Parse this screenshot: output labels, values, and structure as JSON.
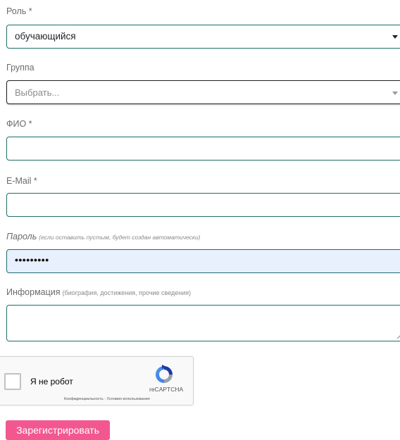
{
  "form": {
    "role": {
      "label": "Роль *",
      "value": "обучающийся"
    },
    "group": {
      "label": "Группа",
      "placeholder": "Выбрать..."
    },
    "fio": {
      "label": "ФИО *",
      "value": ""
    },
    "email": {
      "label": "E-Mail *",
      "value": ""
    },
    "password": {
      "label": "Пароль",
      "hint": "(если оставить пустым, будет создан автоматически)",
      "value": "•••••••••"
    },
    "info": {
      "label": "Информация",
      "note": "(биография, достижения, прочие сведения)",
      "value": ""
    },
    "captcha": {
      "checkbox_label": "Я не робот",
      "brand": "reCAPTCHA",
      "terms": "Конфиденциальность - Условия использования"
    },
    "submit_label": "Зарегистрировать"
  },
  "colors": {
    "input_border": "#1f6d6a",
    "autofill_bg": "#e8f0fe",
    "submit_bg": "#f2588f"
  },
  "icons": [
    "caret-down-icon",
    "recaptcha-logo-icon",
    "resize-handle-icon"
  ]
}
